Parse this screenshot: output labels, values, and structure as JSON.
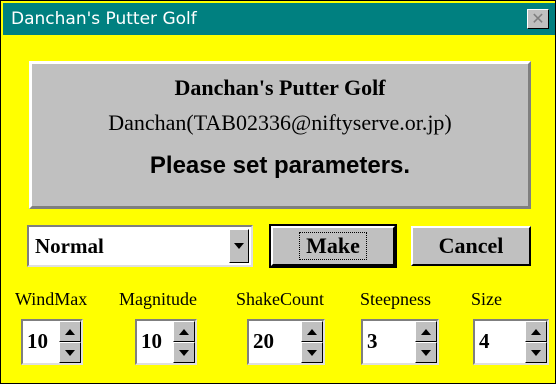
{
  "window": {
    "title": "Danchan's Putter Golf",
    "close_icon": "close-icon"
  },
  "banner": {
    "line1": "Danchan's Putter Golf",
    "line2": "Danchan(TAB02336@niftyserve.or.jp)",
    "line3": "Please set parameters."
  },
  "difficulty": {
    "selected": "Normal"
  },
  "buttons": {
    "make": "Make",
    "cancel": "Cancel"
  },
  "params": [
    {
      "label": "WindMax",
      "value": "10"
    },
    {
      "label": "Magnitude",
      "value": "10"
    },
    {
      "label": "ShakeCount",
      "value": "20"
    },
    {
      "label": "Steepness",
      "value": "3"
    },
    {
      "label": "Size",
      "value": "4"
    }
  ],
  "colors": {
    "background": "#ffff00",
    "titlebar": "#008080",
    "panel": "#c0c0c0"
  }
}
